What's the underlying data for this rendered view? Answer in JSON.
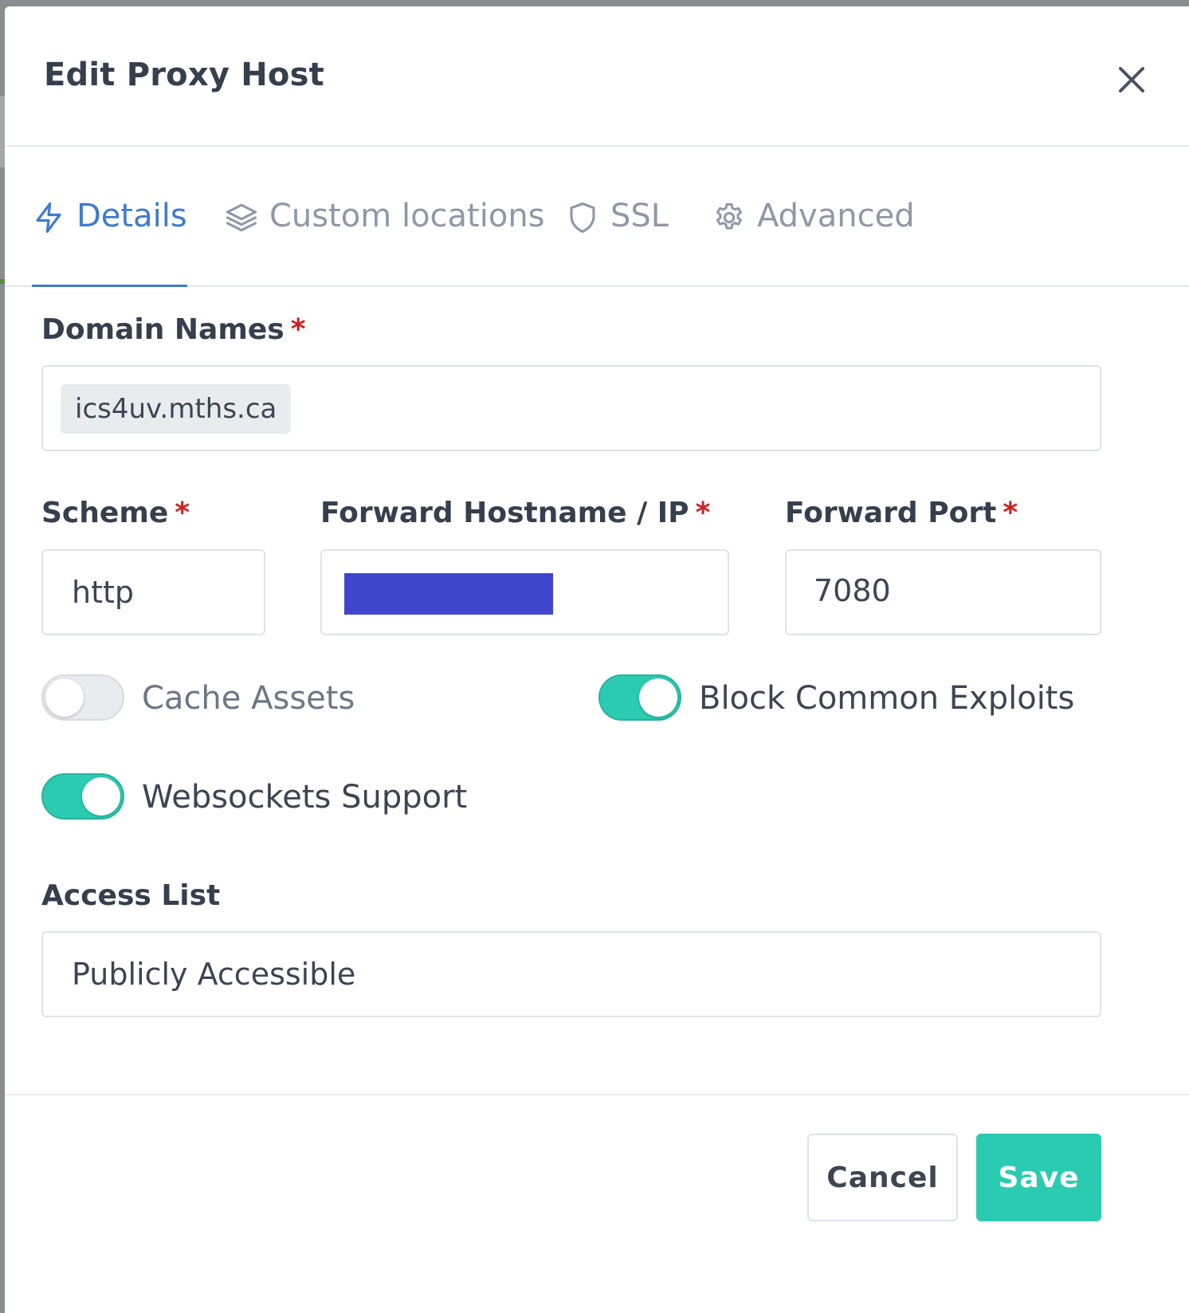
{
  "modal": {
    "title": "Edit Proxy Host"
  },
  "tabs": [
    {
      "label": "Details",
      "icon": "lightning-icon",
      "active": true
    },
    {
      "label": "Custom locations",
      "icon": "layers-icon",
      "active": false
    },
    {
      "label": "SSL",
      "icon": "shield-icon",
      "active": false
    },
    {
      "label": "Advanced",
      "icon": "gear-icon",
      "active": false
    }
  ],
  "form": {
    "domain_names": {
      "label": "Domain Names",
      "required": "*",
      "chips": [
        "ics4uv.mths.ca"
      ]
    },
    "scheme": {
      "label": "Scheme",
      "required": "*",
      "value": "http"
    },
    "forward_host": {
      "label": "Forward Hostname / IP",
      "required": "*"
    },
    "forward_port": {
      "label": "Forward Port",
      "required": "*",
      "value": "7080"
    },
    "toggles": {
      "cache_assets": {
        "label": "Cache Assets",
        "enabled": false
      },
      "block_exploits": {
        "label": "Block Common Exploits",
        "enabled": true
      },
      "websockets": {
        "label": "Websockets Support",
        "enabled": true
      }
    },
    "access_list": {
      "label": "Access List",
      "value": "Publicly Accessible"
    }
  },
  "footer": {
    "cancel_label": "Cancel",
    "save_label": "Save"
  },
  "colors": {
    "accent_blue": "#3f7bd0",
    "toggle_on": "#2bcbb2",
    "required_red": "#cd201f",
    "redaction": "#4046cc"
  }
}
